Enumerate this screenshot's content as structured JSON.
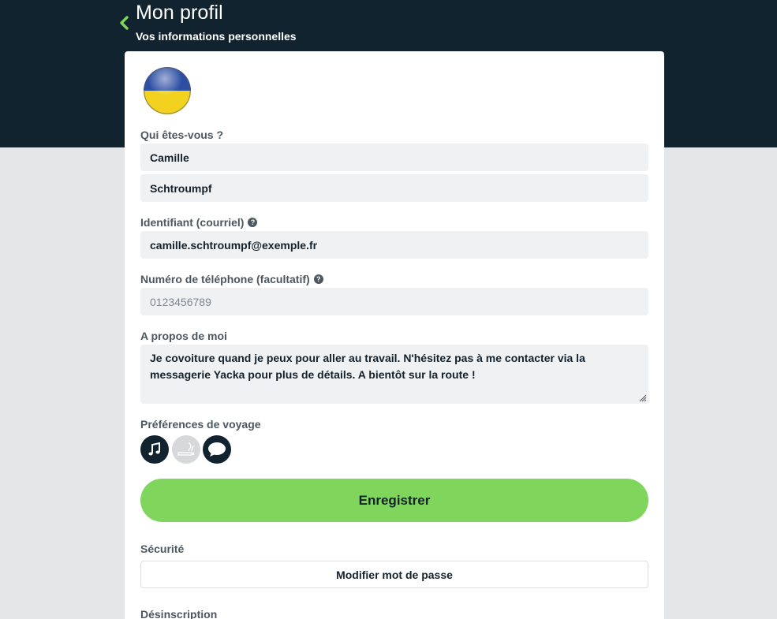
{
  "header": {
    "title": "Mon profil",
    "subtitle": "Vos informations personnelles"
  },
  "colors": {
    "header_bg": "#11232f",
    "accent": "#80d65c",
    "flag_top": "#2d4fa3",
    "flag_bottom": "#f2d21f"
  },
  "profile": {
    "avatar_icon": "ukraine-flag-icon",
    "who_label": "Qui êtes-vous ?",
    "first_name": "Camille",
    "last_name": "Schtroumpf",
    "email_label": "Identifiant (courriel)",
    "email": "camille.schtroumpf@exemple.fr",
    "phone_label": "Numéro de téléphone (facultatif)",
    "phone_placeholder": "0123456789",
    "about_label": "A propos de moi",
    "about": "Je covoiture quand je peux pour aller au travail. N'hésitez pas à me contacter via la messagerie Yacka pour plus de détails. A bientôt sur la route !",
    "prefs_label": "Préférences de voyage",
    "prefs": [
      {
        "icon": "music-icon",
        "enabled": true
      },
      {
        "icon": "smoking-icon",
        "enabled": false
      },
      {
        "icon": "chat-icon",
        "enabled": true
      }
    ],
    "save_label": "Enregistrer"
  },
  "security": {
    "label": "Sécurité",
    "change_password_label": "Modifier mot de passe"
  },
  "unsubscribe": {
    "label": "Désinscription"
  }
}
